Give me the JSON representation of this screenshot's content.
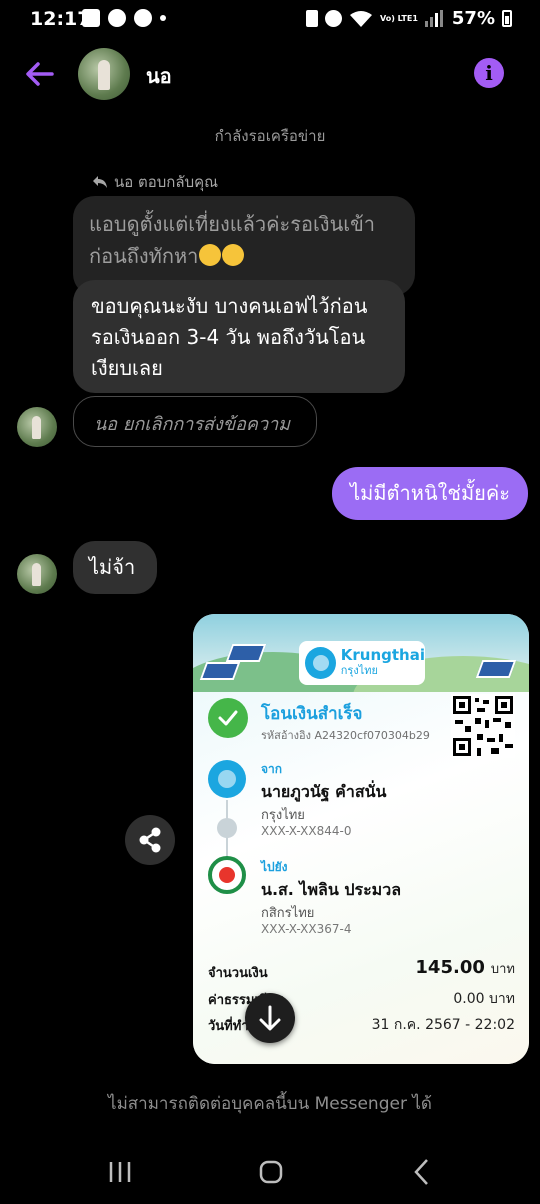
{
  "status_bar": {
    "time": "12:17",
    "battery_percent": "57%",
    "network": "Vo) LTE1"
  },
  "header": {
    "contact_name": "นอ",
    "info_icon": "info-icon",
    "back_icon": "arrow-left-icon"
  },
  "chat": {
    "network_status": "กำลังรอเครือข่าย",
    "reply_label": "นอ ตอบกลับคุณ",
    "quoted_message": "แอบดูตั้งแต่เที่ยงแล้วค่ะรอเงินเข้าก่อนถึงทักหา",
    "incoming_1": "ขอบคุณนะงับ บางคนเอฟไว้ก่อนรอเงินออก 3-4 วัน พอถึงวันโอนเงียบเลย",
    "unsent_notice": "นอ ยกเลิกการส่งข้อความ",
    "outgoing_1": "ไม่มีตำหนิใช่มั้ยค่ะ",
    "incoming_2": "ไม่จ้า",
    "footer_note": "ไม่สามารถติดต่อบุคคลนี้บน Messenger ได้"
  },
  "receipt": {
    "bank_brand": "Krungthai",
    "bank_brand_thai": "กรุงไทย",
    "title": "โอนเงินสำเร็จ",
    "reference": "รหัสอ้างอิง A24320cf070304b29",
    "from_label": "จาก",
    "from_name": "นายภูวนัฐ คำสนั่น",
    "from_bank": "กรุงไทย",
    "from_account": "XXX-X-XX844-0",
    "to_label": "ไปยัง",
    "to_name": "น.ส. ไพลิน ประมวล",
    "to_bank": "กสิกรไทย",
    "to_account": "XXX-X-XX367-4",
    "amount_label": "จำนวนเงิน",
    "amount_value": "145.00",
    "amount_unit": "บาท",
    "fee_label": "ค่าธรรมเนียม",
    "fee_value": "0.00 บาท",
    "date_label": "วันที่ทำรายการ",
    "date_value": "31 ก.ค. 2567 - 22:02"
  },
  "colors": {
    "accent": "#9b6cf4",
    "info": "#a35cf4",
    "bubble_in": "#303030",
    "success_green": "#45b649",
    "ktb_blue": "#1ca0de"
  }
}
